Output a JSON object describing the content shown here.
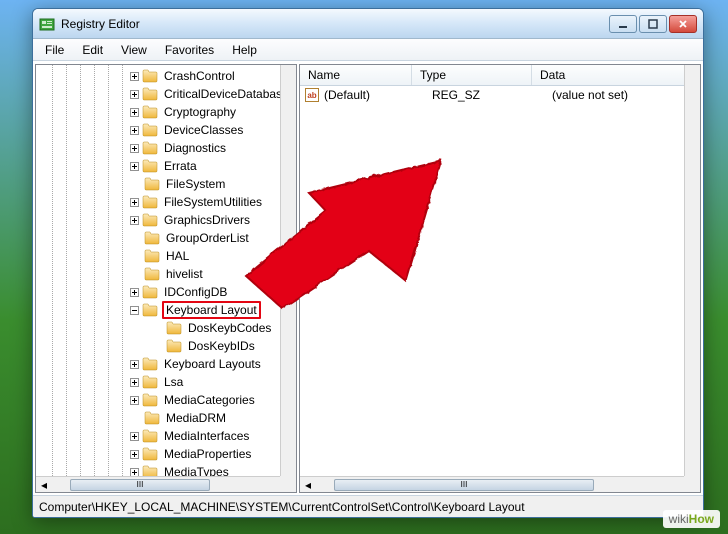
{
  "window": {
    "title": "Registry Editor"
  },
  "menu": {
    "file": "File",
    "edit": "Edit",
    "view": "View",
    "favorites": "Favorites",
    "help": "Help"
  },
  "tree": {
    "items": [
      {
        "label": "CrashControl",
        "exp": "plus"
      },
      {
        "label": "CriticalDeviceDatabase",
        "exp": "plus"
      },
      {
        "label": "Cryptography",
        "exp": "plus"
      },
      {
        "label": "DeviceClasses",
        "exp": "plus"
      },
      {
        "label": "Diagnostics",
        "exp": "plus"
      },
      {
        "label": "Errata",
        "exp": "plus"
      },
      {
        "label": "FileSystem",
        "exp": "none"
      },
      {
        "label": "FileSystemUtilities",
        "exp": "plus"
      },
      {
        "label": "GraphicsDrivers",
        "exp": "plus"
      },
      {
        "label": "GroupOrderList",
        "exp": "none"
      },
      {
        "label": "HAL",
        "exp": "none"
      },
      {
        "label": "hivelist",
        "exp": "none"
      },
      {
        "label": "IDConfigDB",
        "exp": "plus"
      },
      {
        "label": "Keyboard Layout",
        "exp": "minus",
        "selected": true
      },
      {
        "label": "DosKeybCodes",
        "exp": "none",
        "indent": 1
      },
      {
        "label": "DosKeybIDs",
        "exp": "none",
        "indent": 1
      },
      {
        "label": "Keyboard Layouts",
        "exp": "plus"
      },
      {
        "label": "Lsa",
        "exp": "plus"
      },
      {
        "label": "MediaCategories",
        "exp": "plus"
      },
      {
        "label": "MediaDRM",
        "exp": "none"
      },
      {
        "label": "MediaInterfaces",
        "exp": "plus"
      },
      {
        "label": "MediaProperties",
        "exp": "plus"
      },
      {
        "label": "MediaTypes",
        "exp": "plus"
      }
    ]
  },
  "list": {
    "columns": {
      "name": "Name",
      "type": "Type",
      "data": "Data"
    },
    "rows": [
      {
        "icon": "ab",
        "name": "(Default)",
        "type": "REG_SZ",
        "data": "(value not set)"
      }
    ]
  },
  "status": {
    "path": "Computer\\HKEY_LOCAL_MACHINE\\SYSTEM\\CurrentControlSet\\Control\\Keyboard Layout"
  },
  "watermark": {
    "prefix": "wiki",
    "suffix": "How"
  },
  "scroll_caption": "III"
}
